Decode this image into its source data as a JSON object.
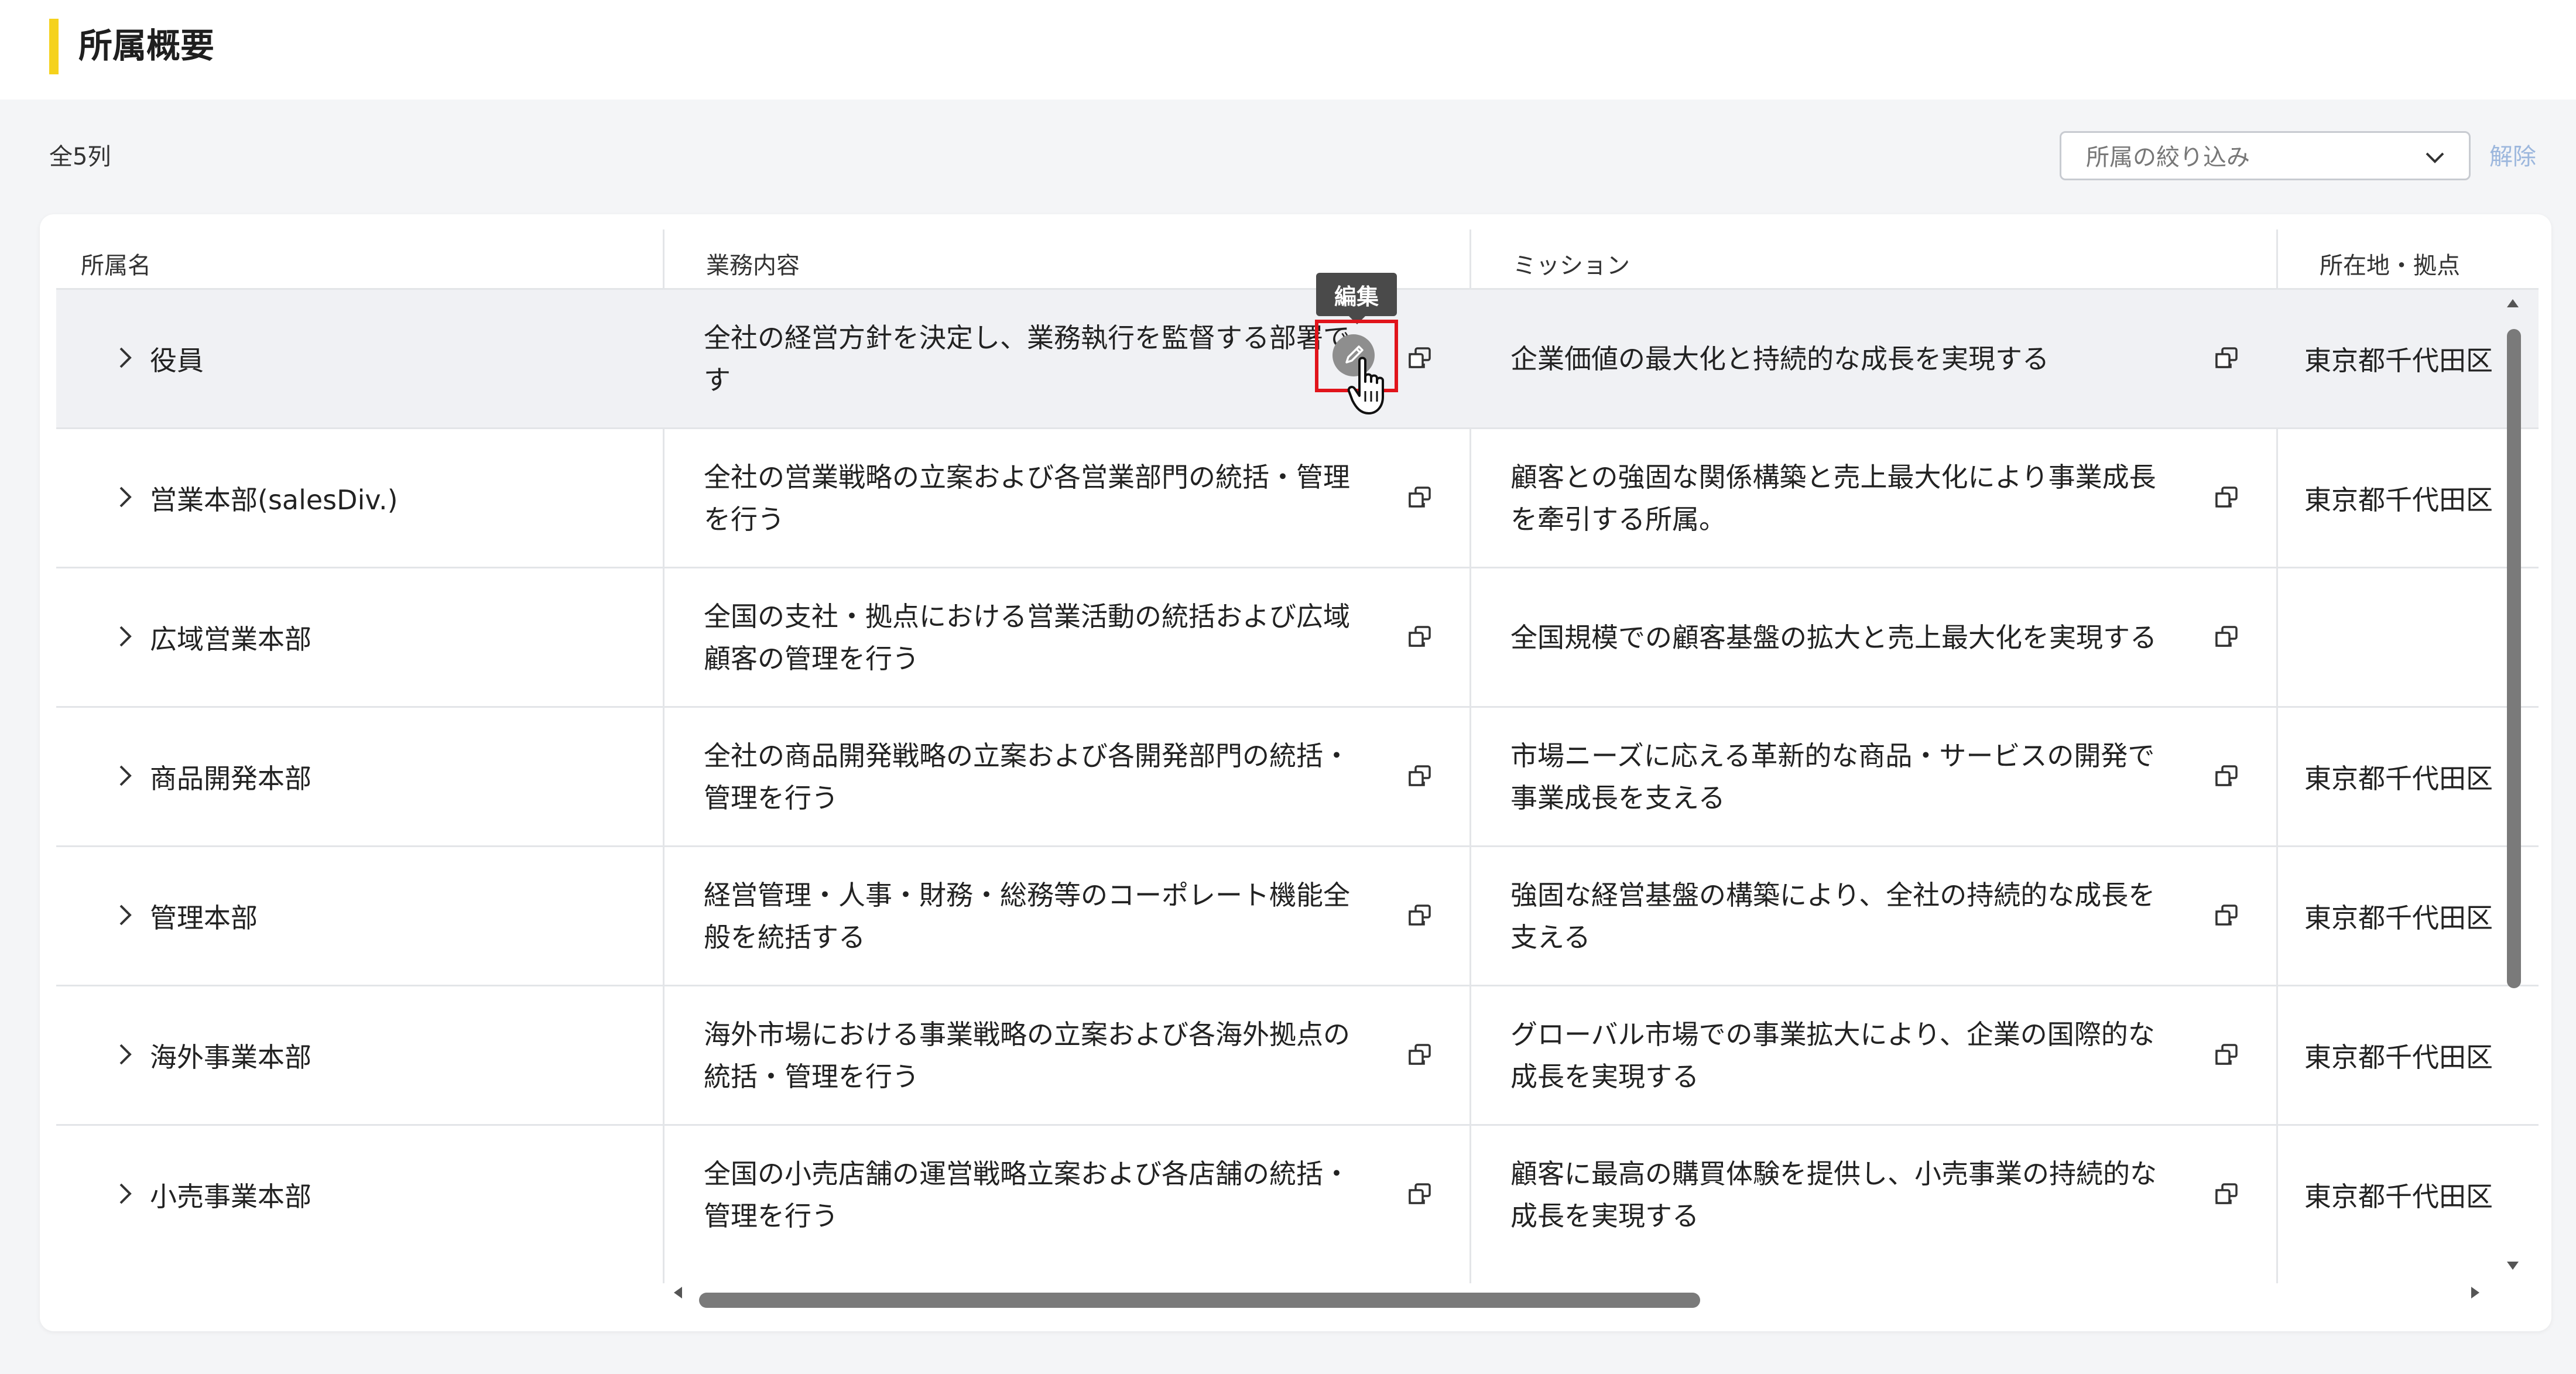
{
  "page": {
    "title": "所属概要"
  },
  "toolbar": {
    "count_label": "全5列",
    "filter_placeholder": "所属の絞り込み",
    "clear_label": "解除"
  },
  "table": {
    "columns": [
      "所属名",
      "業務内容",
      "ミッション",
      "所在地・拠点"
    ],
    "rows": [
      {
        "name": "役員",
        "business": "全社の経営方針を決定し、業務執行を監督する部署です",
        "mission": "企業価値の最大化と持続的な成長を実現する",
        "location": "東京都千代田区"
      },
      {
        "name": "営業本部(salesDiv.)",
        "business": "全社の営業戦略の立案および各営業部門の統括・管理を行う",
        "mission": "顧客との強固な関係構築と売上最大化により事業成長を牽引する所属。",
        "location": "東京都千代田区"
      },
      {
        "name": "広域営業本部",
        "business": "全国の支社・拠点における営業活動の統括および広域顧客の管理を行う",
        "mission": "全国規模での顧客基盤の拡大と売上最大化を実現する",
        "location": ""
      },
      {
        "name": "商品開発本部",
        "business": "全社の商品開発戦略の立案および各開発部門の統括・管理を行う",
        "mission": "市場ニーズに応える革新的な商品・サービスの開発で事業成長を支える",
        "location": "東京都千代田区"
      },
      {
        "name": "管理本部",
        "business": "経営管理・人事・財務・総務等のコーポレート機能全般を統括する",
        "mission": "強固な経営基盤の構築により、全社の持続的な成長を支える",
        "location": "東京都千代田区"
      },
      {
        "name": "海外事業本部",
        "business": "海外市場における事業戦略の立案および各海外拠点の統括・管理を行う",
        "mission": "グローバル市場での事業拡大により、企業の国際的な成長を実現する",
        "location": "東京都千代田区"
      },
      {
        "name": "小売事業本部",
        "business": "全国の小売店舗の運営戦略立案および各店舗の統括・管理を行う",
        "mission": "顧客に最高の購買体験を提供し、小売事業の持続的な成長を実現する",
        "location": "東京都千代田区"
      }
    ]
  },
  "tooltip": {
    "label": "編集"
  },
  "icons": {
    "expand": "chevron-right-icon",
    "copy": "copy-icon",
    "edit": "pencil-icon",
    "dropdown": "chevron-down-icon"
  },
  "colors": {
    "accent": "#f5d21c",
    "highlight": "#e1141b",
    "clear_link": "#9cb7dd"
  }
}
